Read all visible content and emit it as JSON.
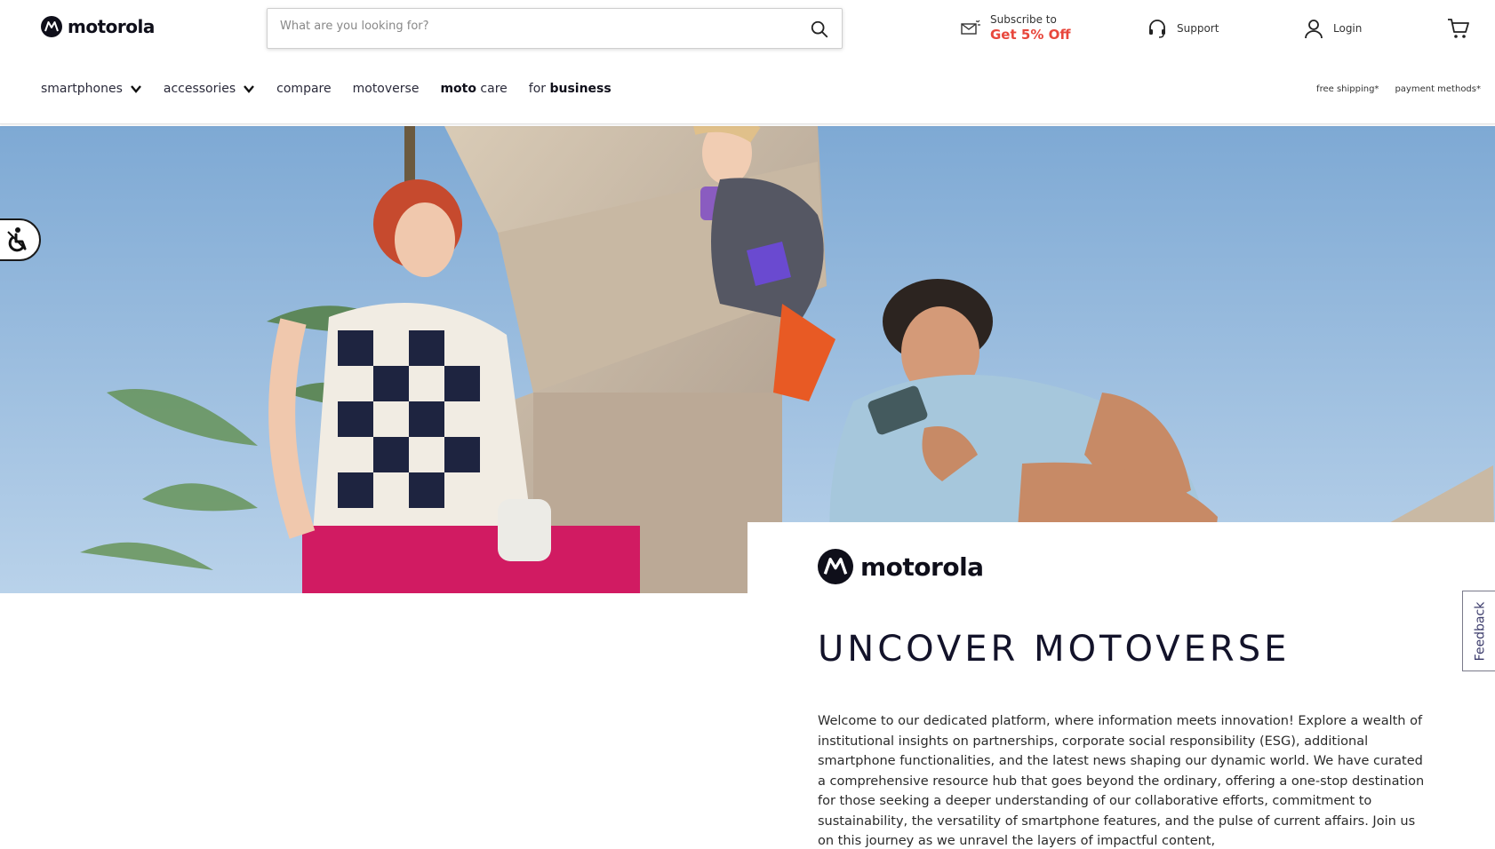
{
  "header": {
    "brand": "motorola",
    "search_placeholder": "What are you looking for?",
    "subscribe_line1": "Subscribe to",
    "subscribe_offer": "Get 5% Off",
    "support_label": "Support",
    "login_label": "Login"
  },
  "nav": {
    "smartphones": "smartphones",
    "accessories": "accessories",
    "compare": "compare",
    "motoverse": "motoverse",
    "moto_care_bold": "moto",
    "moto_care_rest": " care",
    "for_business_pre": "for ",
    "for_business_bold": "business",
    "free_shipping": "free shipping*",
    "payment_methods": "payment methods*"
  },
  "card": {
    "brand": "motorola",
    "title": "UNCOVER MOTOVERSE",
    "body": "Welcome to our dedicated platform, where information meets innovation! Explore a wealth of institutional insights on partnerships, corporate social responsibility (ESG), additional smartphone functionalities, and the latest news shaping our dynamic world. We have curated a comprehensive resource hub that goes beyond the ordinary, offering a one-stop destination for those seeking a deeper understanding of our collaborative efforts, commitment to sustainability, the versatility of smartphone features, and the pulse of current affairs. Join us on this journey as we unravel the layers of impactful content,"
  },
  "feedback_label": "Feedback",
  "colors": {
    "offer_red": "#e8473c",
    "navy": "#13132a",
    "sky": "#8fb7dd"
  }
}
